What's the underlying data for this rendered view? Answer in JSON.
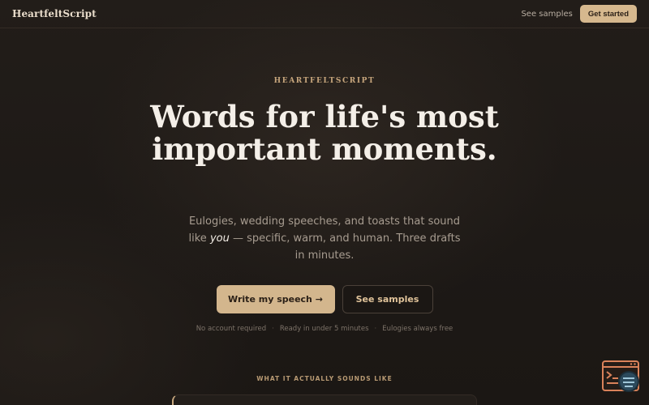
{
  "header": {
    "logo": "HeartfeltScript",
    "nav_link": "See samples",
    "cta": "Get started"
  },
  "hero": {
    "eyebrow": "HEARTFELTSCRIPT",
    "headline": "Words for life's most important moments.",
    "sub_before": "Eulogies, wedding speeches, and toasts that sound like ",
    "sub_em": "you",
    "sub_after": " — specific, warm, and human. Three drafts in minutes.",
    "primary_cta": "Write my speech →",
    "secondary_cta": "See samples",
    "meta": [
      "No account required",
      "Ready in under 5 minutes",
      "Eulogies always free"
    ]
  },
  "section": {
    "label": "WHAT IT ACTUALLY SOUNDS LIKE"
  },
  "colors": {
    "background": "#1e1a17",
    "accent": "#d3b68d",
    "heading": "#f4efe8",
    "muted": "#a79c90"
  },
  "icons": {
    "help_widget": "terminal-chat-icon"
  }
}
